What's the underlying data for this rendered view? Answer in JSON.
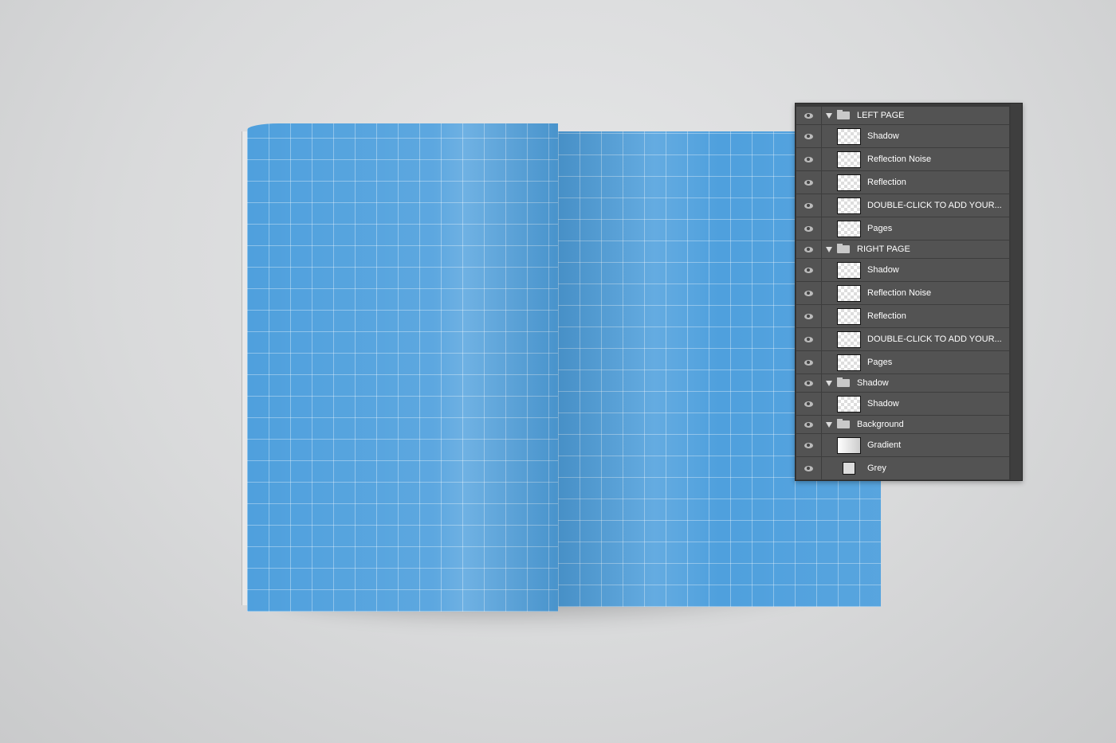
{
  "layers_panel": {
    "rows": [
      {
        "type": "group",
        "label": "LEFT PAGE"
      },
      {
        "type": "layer",
        "label": "Shadow",
        "thumb": "transparent"
      },
      {
        "type": "layer",
        "label": "Reflection Noise",
        "thumb": "transparent"
      },
      {
        "type": "layer",
        "label": "Reflection",
        "thumb": "transparent"
      },
      {
        "type": "layer",
        "label": "DOUBLE-CLICK TO ADD YOUR...",
        "thumb": "smart-object"
      },
      {
        "type": "layer",
        "label": "Pages",
        "thumb": "transparent"
      },
      {
        "type": "group",
        "label": "RIGHT PAGE"
      },
      {
        "type": "layer",
        "label": "Shadow",
        "thumb": "transparent"
      },
      {
        "type": "layer",
        "label": "Reflection Noise",
        "thumb": "transparent"
      },
      {
        "type": "layer",
        "label": "Reflection",
        "thumb": "transparent"
      },
      {
        "type": "layer",
        "label": "DOUBLE-CLICK TO ADD YOUR...",
        "thumb": "smart-object"
      },
      {
        "type": "layer",
        "label": "Pages",
        "thumb": "transparent"
      },
      {
        "type": "group",
        "label": "Shadow"
      },
      {
        "type": "layer",
        "label": "Shadow",
        "thumb": "transparent"
      },
      {
        "type": "group",
        "label": "Background"
      },
      {
        "type": "layer",
        "label": "Gradient",
        "thumb": "gradient"
      },
      {
        "type": "layer",
        "label": "Grey",
        "thumb": "solid"
      }
    ]
  },
  "colors": {
    "page_blue": "#4fa0dd",
    "panel_bg": "#535353",
    "background": "#dcddde"
  }
}
